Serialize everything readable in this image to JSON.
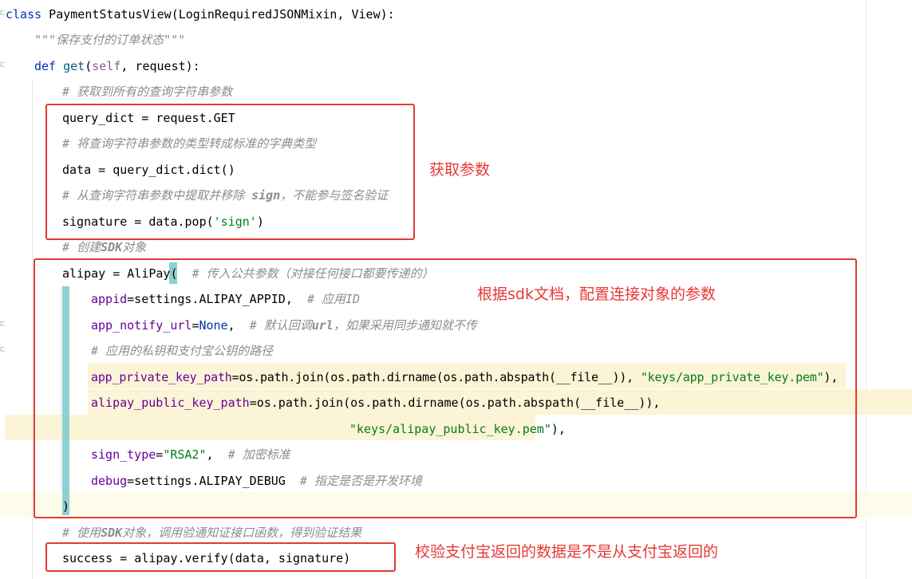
{
  "code": {
    "line1": {
      "kw": "class",
      "cls": " PaymentStatusView",
      "rest": "(LoginRequiredJSONMixin, View):"
    },
    "line2": {
      "doc": "\"\"\"保存支付的订单状态\"\"\""
    },
    "line3": {
      "kw": "def",
      "fn": " get",
      "p1": "(",
      "self": "self",
      "rest": ", request):"
    },
    "line4": {
      "cmt": "# 获取到所有的查询字符串参数"
    },
    "line5": {
      "text": "query_dict = request.GET"
    },
    "line6": {
      "cmt": "# 将查询字符串参数的类型转成标准的字典类型"
    },
    "line7": {
      "text": "data = query_dict.dict()"
    },
    "line8": {
      "cmt1": "# 从查询字符串参数中提取并移除 ",
      "cmtb": "sign",
      "cmt2": "，不能参与签名验证"
    },
    "line9": {
      "a": "signature = data.pop(",
      "str": "'sign'",
      "b": ")"
    },
    "line10": {
      "cmt1": "# 创建",
      "cmtb": "SDK",
      "cmt2": "对象"
    },
    "line11": {
      "a": "alipay = AliPay",
      "paren": "(",
      "sp": "  ",
      "cmt": "# 传入公共参数（对接任何接口都要传递的）"
    },
    "line12": {
      "param": "appid",
      "a": "=settings.ALIPAY_APPID,  ",
      "cmt": "# 应用ID"
    },
    "line13": {
      "param": "app_notify_url",
      "a": "=",
      "kw": "None",
      "b": ",  ",
      "cmt1": "# 默认回调",
      "cmtb": "url",
      "cmt2": "，如果采用同步通知就不传"
    },
    "line14": {
      "cmt": "# 应用的私钥和支付宝公钥的路径"
    },
    "line15": {
      "param": "app_private_key_path",
      "a": "=os.path.join(os.path.dirname(os.path.abspath(__file__)), ",
      "str": "\"keys/app_private_key.pem\"",
      "b": "),"
    },
    "line16": {
      "param": "alipay_public_key_path",
      "a": "=os.path.join(os.path.dirname(os.path.abspath(__file__)),"
    },
    "line17": {
      "str": "\"keys/alipay_public_key.pem\"",
      "b": "),"
    },
    "line18": {
      "param": "sign_type",
      "a": "=",
      "str": "\"RSA2\"",
      "b": ",  ",
      "cmt": "# 加密标准"
    },
    "line19": {
      "param": "debug",
      "a": "=settings.ALIPAY_DEBUG  ",
      "cmt": "# 指定是否是开发环境"
    },
    "line20": {
      "text": ")"
    },
    "line21": {
      "cmt1": "# 使用",
      "cmtb": "SDK",
      "cmt2": "对象，调用验通知证接口函数，得到验证结果"
    },
    "line22": {
      "text": "success = alipay.verify(data, signature)"
    }
  },
  "annotations": {
    "get_params": "获取参数",
    "sdk_config": "根据sdk文档，配置连接对象的参数",
    "verify": "校验支付宝返回的数据是不是从支付宝返回的"
  },
  "colors": {
    "annotation": "#e53935",
    "keyword": "#0033b3",
    "string": "#067d17",
    "comment": "#8c8c8c",
    "param": "#660099"
  }
}
